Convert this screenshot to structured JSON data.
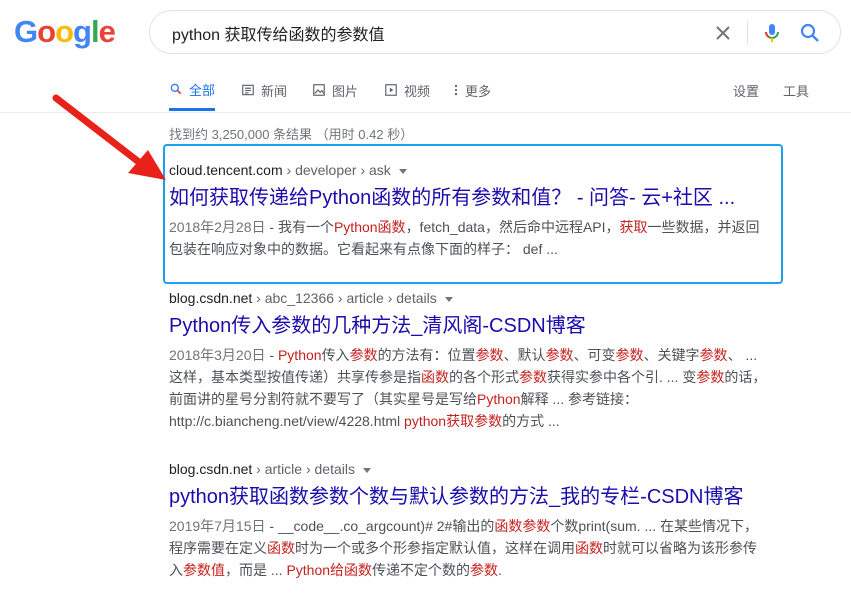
{
  "logo": {
    "text": "Google"
  },
  "search": {
    "query": "python 获取传给函数的参数值"
  },
  "tabs": [
    {
      "label": "全部",
      "icon": "search-icon"
    },
    {
      "label": "新闻",
      "icon": "news-icon"
    },
    {
      "label": "图片",
      "icon": "image-icon"
    },
    {
      "label": "视频",
      "icon": "video-icon"
    },
    {
      "label": "更多",
      "icon": "more-vert-icon"
    }
  ],
  "tools": {
    "settings": "设置",
    "tools": "工具"
  },
  "stats": "找到约 3,250,000 条结果 （用时 0.42 秒）",
  "results": [
    {
      "domain": "cloud.tencent.com",
      "path": " › developer › ask",
      "title": "如何获取传递给Python函数的所有参数和值？ - 问答- 云+社区 ...",
      "date": "2018年2月28日",
      "lines": [
        [
          " - 我有一个",
          "Python函数",
          "，fetch_data，然后命中远程API，",
          "获取",
          "一些数据，并返回"
        ],
        [
          "包装在响应对象中的数据。它看起来有点像下面的样子： def ..."
        ]
      ]
    },
    {
      "domain": "blog.csdn.net",
      "path": " › abc_12366 › article › details",
      "title": "Python传入参数的几种方法_清风阁-CSDN博客",
      "date": "2018年3月20日",
      "lines": [
        [
          " - ",
          "Python",
          "传入",
          "参数",
          "的方法有：位置",
          "参数",
          "、默认",
          "参数",
          "、可变",
          "参数",
          "、关键字",
          "参数",
          "、 ..."
        ],
        [
          "这样，基本类型按值传递）共享传参是指",
          "函数",
          "的各个形式",
          "参数",
          "获得实参中各个引. ... 变",
          "参数",
          "的话，"
        ],
        [
          "前面讲的星号分割符就不要写了（其实星号是写给",
          "Python",
          "解释 ... 参考链接："
        ],
        [
          "http://c.biancheng.net/view/4228.html ",
          "python获取参数",
          "的方式 ..."
        ]
      ]
    },
    {
      "domain": "blog.csdn.net",
      "path": " › article › details",
      "title": "python获取函数参数个数与默认参数的方法_我的专栏-CSDN博客",
      "date": "2019年7月15日",
      "lines": [
        [
          " - __code__.co_argcount)# 2#输出的",
          "函数参数",
          "个数print(sum. ... 在某些情况下，"
        ],
        [
          "程序需要在定义",
          "函数",
          "时为一个或多个形参指定默认值，这样在调用",
          "函数",
          "时就可以省略为该形参传"
        ],
        [
          "入",
          "参数值",
          "，而是 ... ",
          "Python给函数",
          "传递不定个数的",
          "参数",
          "."
        ]
      ]
    }
  ],
  "colors": {
    "link": "#1a0dab",
    "highlight": "#c5221f",
    "accent": "#1a73e8",
    "annotation_box": "#1aa1f0",
    "arrow": "#e8221b"
  }
}
